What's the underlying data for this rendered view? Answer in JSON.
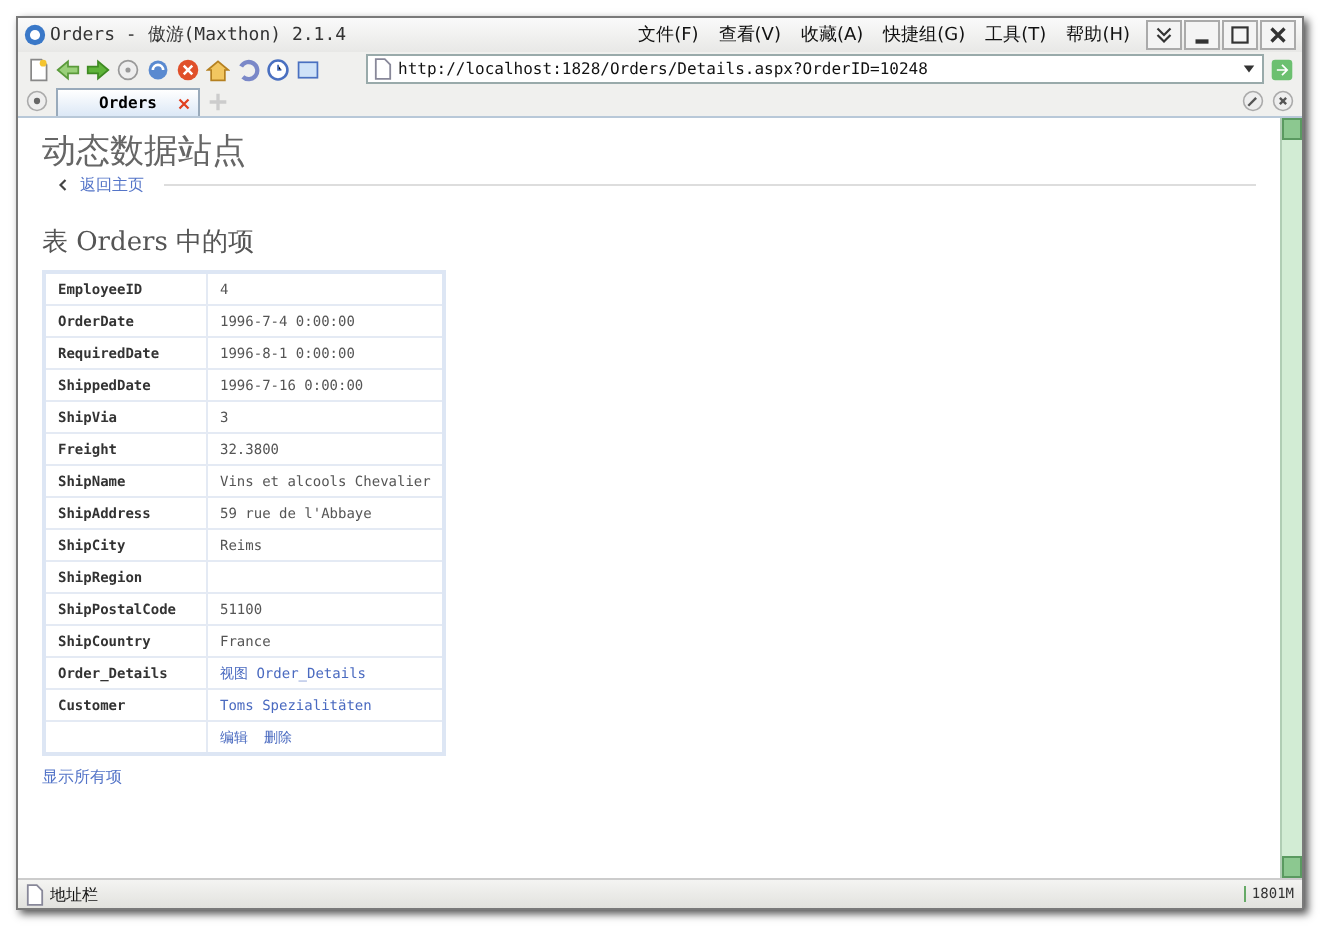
{
  "window": {
    "title": "Orders - 傲游(Maxthon) 2.1.4"
  },
  "menu": [
    "文件(F)",
    "查看(V)",
    "收藏(A)",
    "快捷组(G)",
    "工具(T)",
    "帮助(H)"
  ],
  "address": {
    "url": "http://localhost:1828/Orders/Details.aspx?OrderID=10248"
  },
  "tabs": [
    {
      "label": "Orders",
      "selected": true
    }
  ],
  "page": {
    "site_title": "动态数据站点",
    "back_link": "返回主页",
    "heading": "表 Orders 中的项",
    "rows": [
      {
        "kind": "text",
        "label": "EmployeeID",
        "value": "4"
      },
      {
        "kind": "text",
        "label": "OrderDate",
        "value": "1996-7-4 0:00:00"
      },
      {
        "kind": "text",
        "label": "RequiredDate",
        "value": "1996-8-1 0:00:00"
      },
      {
        "kind": "text",
        "label": "ShippedDate",
        "value": "1996-7-16 0:00:00"
      },
      {
        "kind": "text",
        "label": "ShipVia",
        "value": "3"
      },
      {
        "kind": "text",
        "label": "Freight",
        "value": "32.3800"
      },
      {
        "kind": "text",
        "label": "ShipName",
        "value": "Vins et alcools Chevalier"
      },
      {
        "kind": "text",
        "label": "ShipAddress",
        "value": "59 rue de l'Abbaye"
      },
      {
        "kind": "text",
        "label": "ShipCity",
        "value": "Reims"
      },
      {
        "kind": "text",
        "label": "ShipRegion"
      },
      {
        "kind": "text",
        "label": "ShipPostalCode",
        "value": "51100"
      },
      {
        "kind": "text",
        "label": "ShipCountry",
        "value": "France"
      },
      {
        "kind": "link",
        "label": "Order_Details",
        "value": "视图 Order_Details"
      },
      {
        "kind": "link",
        "label": "Customer",
        "value": "Toms Spezialitäten"
      },
      {
        "kind": "actions",
        "links": [
          "编辑",
          "删除"
        ]
      }
    ],
    "show_all": "显示所有项"
  },
  "status_bar": {
    "left": "地址栏",
    "right": "1801M"
  }
}
